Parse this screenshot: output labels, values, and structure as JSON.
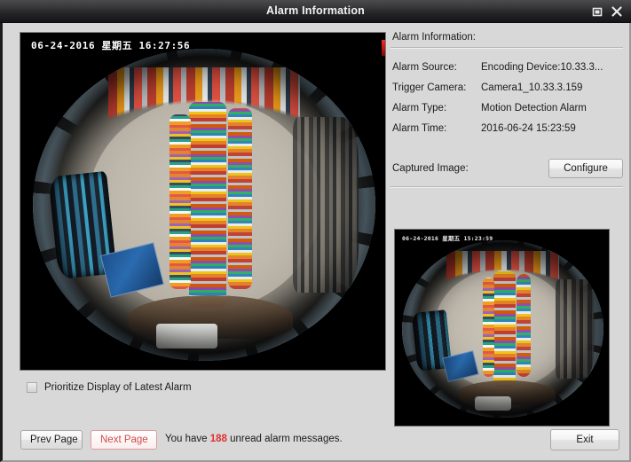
{
  "window": {
    "title": "Alarm Information",
    "restore_icon": "restore-icon",
    "close_icon": "close-icon"
  },
  "video": {
    "osd_timestamp": "06-24-2016 星期五 16:27:56",
    "rec_marker": "recording-indicator"
  },
  "options": {
    "prioritize_label": "Prioritize Display of Latest Alarm",
    "prioritize_checked": false
  },
  "bottom": {
    "prev_label": "Prev Page",
    "next_label": "Next Page",
    "unread_prefix": "You have ",
    "unread_count": "188",
    "unread_suffix": " unread alarm messages.",
    "exit_label": "Exit"
  },
  "info": {
    "section_title": "Alarm Information:",
    "rows": [
      {
        "key": "Alarm Source:",
        "value": "Encoding Device:10.33.3..."
      },
      {
        "key": "Trigger Camera:",
        "value": "Camera1_10.33.3.159"
      },
      {
        "key": "Alarm Type:",
        "value": "Motion Detection Alarm"
      },
      {
        "key": "Alarm Time:",
        "value": "2016-06-24 15:23:59"
      }
    ],
    "captured_label": "Captured Image:",
    "configure_label": "Configure",
    "thumb_osd": "06-24-2016 星期五 15:23:59"
  },
  "colors": {
    "titlebar": "#232325",
    "dialog_bg": "#d8d8d8",
    "accent_red": "#e03030",
    "next_border": "#e09a9a"
  }
}
